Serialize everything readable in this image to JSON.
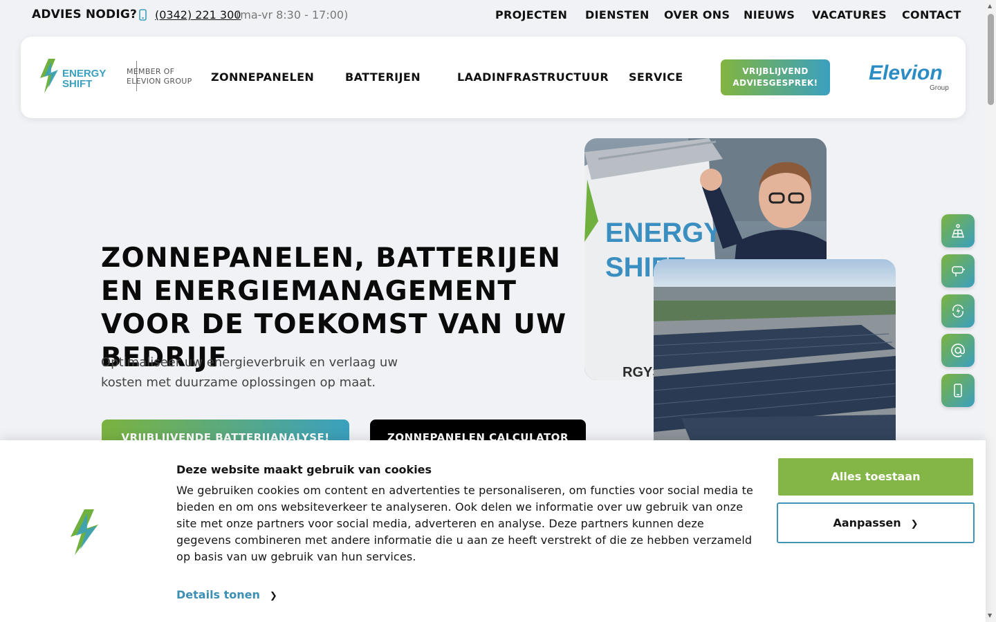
{
  "topbar": {
    "advies": "ADVIES NODIG?",
    "phone": "(0342) 221 300",
    "hours": "(ma-vr 8:30 - 17:00)",
    "nav": [
      "PROJECTEN",
      "DIENSTEN",
      "OVER ONS",
      "NIEUWS",
      "VACATURES",
      "CONTACT"
    ]
  },
  "header": {
    "logo_line1": "ENERGY",
    "logo_line2": "SHIFT",
    "member_line1": "MEMBER OF",
    "member_line2": "ELEVION GROUP",
    "nav": [
      "ZONNEPANELEN",
      "BATTERIJEN",
      "LAADINFRASTRUCTUUR",
      "SERVICE"
    ],
    "cta_line1": "VRIJBLIJVEND",
    "cta_line2": "ADVIESGESPREK!",
    "partner_logo": "Elevion",
    "partner_sub": "Group"
  },
  "hero": {
    "title": "ZONNEPANELEN, BATTERIJEN EN ENERGIEMANAGEMENT VOOR DE TOEKOMST VAN UW BEDRIJF",
    "subtitle": "Optimaliseer uw energieverbruik en verlaag uw kosten met duurzame oplossingen op maat.",
    "btn_primary": "VRIJBLIJVENDE BATTERIJANALYSE!",
    "btn_secondary": "ZONNEPANELEN CALCULATOR",
    "van_text_1": "ENERGY",
    "van_text_2": "SHIFT",
    "van_url": "RGYSHIFT.NL"
  },
  "side_icons": [
    "solar-panel-icon",
    "charging-icon",
    "energy-cycle-icon",
    "at-icon",
    "mobile-phone-icon"
  ],
  "cookie": {
    "title": "Deze website maakt gebruik van cookies",
    "text": "We gebruiken cookies om content en advertenties te personaliseren, om functies voor social media te bieden en om ons websiteverkeer te analyseren. Ook delen we informatie over uw gebruik van onze site met onze partners voor social media, adverteren en analyse. Deze partners kunnen deze gegevens combineren met andere informatie die u aan ze heeft verstrekt of die ze hebben verzameld op basis van uw gebruik van hun services.",
    "details": "Details tonen",
    "allow_all": "Alles toestaan",
    "customize": "Aanpassen"
  },
  "colors": {
    "brand_green": "#84b547",
    "brand_blue": "#3c8fb3",
    "page_bg": "#f0f2f6"
  }
}
